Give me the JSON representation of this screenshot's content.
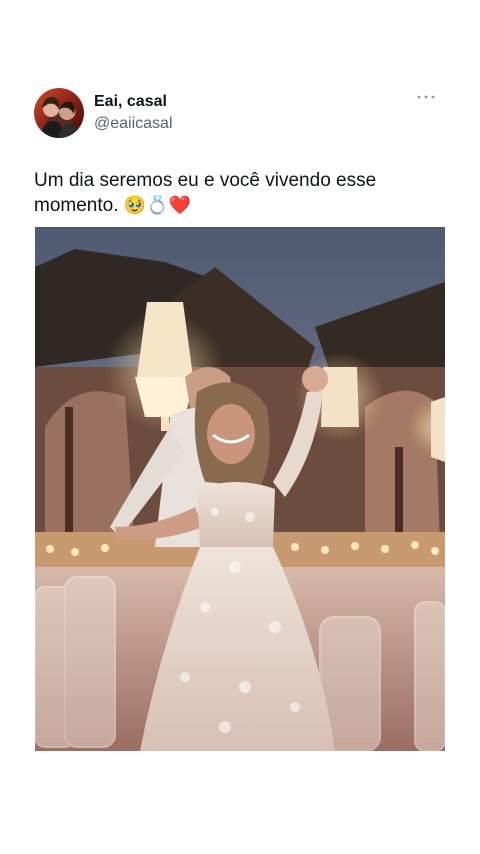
{
  "post": {
    "display_name": "Eai, casal",
    "handle": "@eaiicasal",
    "more_icon": "more-horizontal-icon",
    "text_line1": "Um dia seremos eu e você vivendo esse",
    "text_line2": "momento.",
    "emojis": "🥹💍❤️",
    "media_icon": "photo"
  },
  "colors": {
    "text_primary": "#0f1419",
    "text_secondary": "#536471",
    "background": "#ffffff"
  }
}
